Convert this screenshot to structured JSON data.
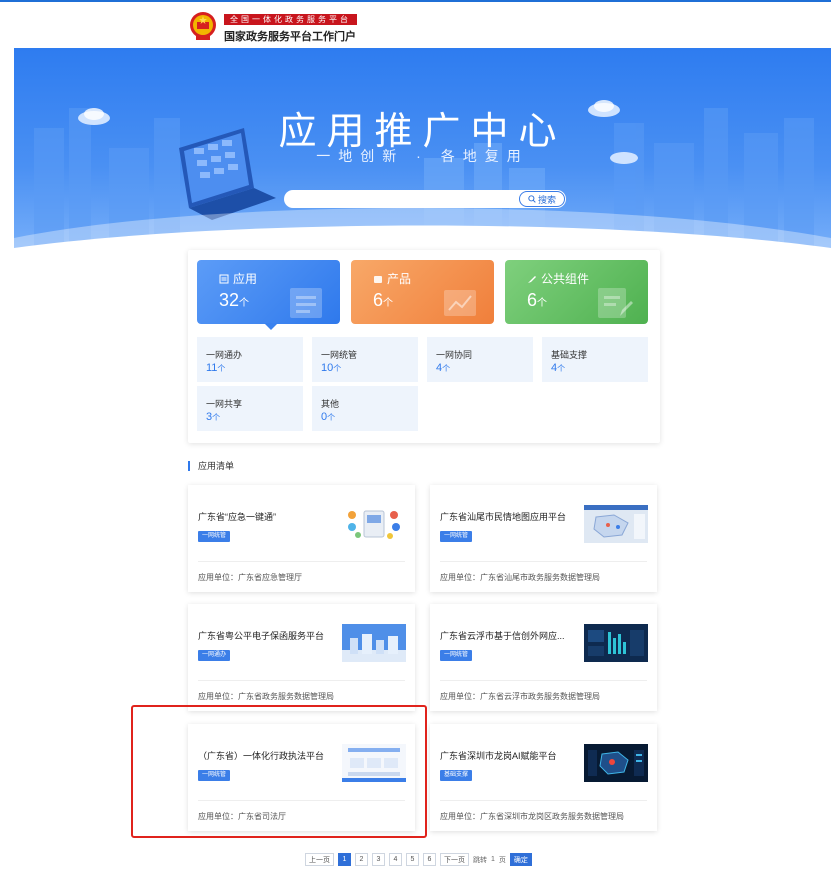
{
  "header": {
    "logo_tag": "全国一体化政务服务平台",
    "logo_title": "国家政务服务平台工作门户"
  },
  "banner": {
    "title": "应用推广中心",
    "subtitle": "一地创新 · 各地复用",
    "search_placeholder": "",
    "search_button": "搜索"
  },
  "stats": {
    "big": [
      {
        "label": "应用",
        "count": "32",
        "unit": "个",
        "icon": "app-icon"
      },
      {
        "label": "产品",
        "count": "6",
        "unit": "个",
        "icon": "product-icon"
      },
      {
        "label": "公共组件",
        "count": "6",
        "unit": "个",
        "icon": "component-icon"
      }
    ],
    "small": [
      {
        "label": "一网通办",
        "count": "11",
        "unit": "个"
      },
      {
        "label": "一网统管",
        "count": "10",
        "unit": "个"
      },
      {
        "label": "一网协同",
        "count": "4",
        "unit": "个"
      },
      {
        "label": "基础支撑",
        "count": "4",
        "unit": "个"
      },
      {
        "label": "一网共享",
        "count": "3",
        "unit": "个"
      },
      {
        "label": "其他",
        "count": "0",
        "unit": "个"
      }
    ]
  },
  "list": {
    "title": "应用清单",
    "unit_prefix": "应用单位：",
    "cards": [
      {
        "name": "广东省“应急一键通”",
        "tag": "一网统管",
        "unit": "广东省应急管理厅"
      },
      {
        "name": "广东省汕尾市民情地图应用平台",
        "tag": "一网统管",
        "unit": "广东省汕尾市政务服务数据管理局"
      },
      {
        "name": "广东省粤公平电子保函服务平台",
        "tag": "一网通办",
        "unit": "广东省政务服务数据管理局"
      },
      {
        "name": "广东省云浮市基于信创外网应...",
        "tag": "一网统管",
        "unit": "广东省云浮市政务服务数据管理局"
      },
      {
        "name": "（广东省）一体化行政执法平台",
        "tag": "一网统管",
        "unit": "广东省司法厅"
      },
      {
        "name": "广东省深圳市龙岗AI赋能平台",
        "tag": "基础支撑",
        "unit": "广东省深圳市龙岗区政务服务数据管理局"
      }
    ]
  },
  "pagination": {
    "prev": "上一页",
    "pages": [
      "1",
      "2",
      "3",
      "4",
      "5",
      "6"
    ],
    "current": "1",
    "next": "下一页",
    "jump_label": "跳转",
    "jump_value": "1",
    "page_suffix": "页",
    "confirm": "确定"
  },
  "colors": {
    "accent": "#2f79ec",
    "highlight": "#e0231c",
    "tile_blue": "#3a82ef",
    "tile_orange": "#f28a45",
    "tile_green": "#5cbb5c"
  }
}
